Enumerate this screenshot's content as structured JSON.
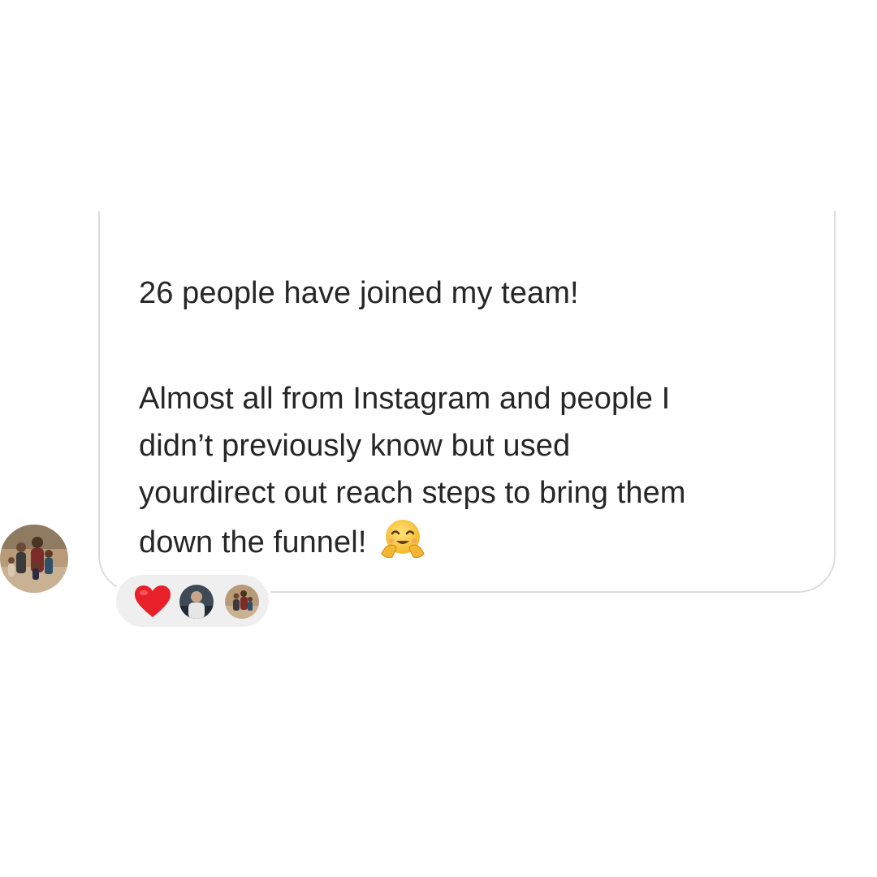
{
  "message": {
    "lines": [
      "26 people have joined my team!",
      "Almost all from Instagram and people I",
      "didn’t previously know but used",
      "yourdirect out reach steps to bring them",
      "down the funnel!"
    ],
    "trailing_emoji": "hugging-face-emoji"
  },
  "sender": {
    "avatar": "family-photo-avatar"
  },
  "reactions": {
    "emoji": "red-heart",
    "reactor_avatars": [
      "reactor-avatar-1",
      "reactor-avatar-2"
    ]
  },
  "colors": {
    "text": "#262626",
    "bubble_border": "#dcdcdc",
    "reaction_pill": "#efefef",
    "heart": "#e8202a",
    "emoji_face": "#f7c844"
  }
}
